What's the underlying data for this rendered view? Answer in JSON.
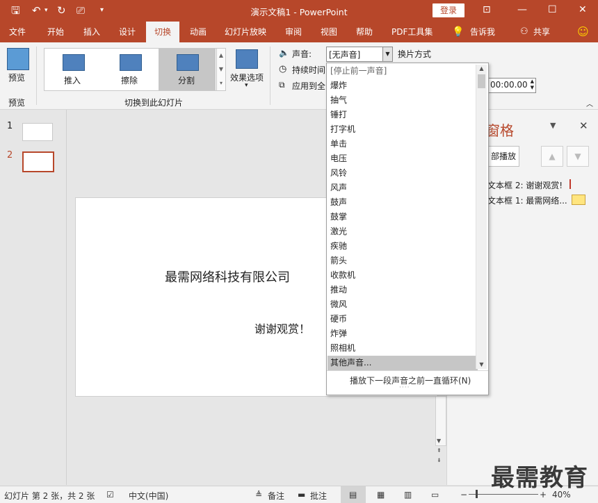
{
  "window": {
    "title": "演示文稿1  -  PowerPoint",
    "login": "登录"
  },
  "tabs": [
    "文件",
    "开始",
    "插入",
    "设计",
    "切换",
    "动画",
    "幻灯片放映",
    "审阅",
    "视图",
    "帮助",
    "PDF工具集",
    "告诉我",
    "共享"
  ],
  "ribbon": {
    "preview_label": "预览",
    "preview_group": "预览",
    "gallery": [
      "推入",
      "擦除",
      "分割"
    ],
    "effect_options": "效果选项",
    "transition_group": "切换到此幻灯片",
    "sound_label": "声音:",
    "sound_value": "[无声音]",
    "switch_mode": "换片方式",
    "duration_label": "持续时间",
    "apply_all": "应用到全",
    "time_value": "00:00.00"
  },
  "thumbnails": [
    {
      "num": "1"
    },
    {
      "num": "2"
    }
  ],
  "slide": {
    "title": "最需网络科技有限公司",
    "subtitle": "谢谢观赏！"
  },
  "pane": {
    "title": "窗格",
    "play_all": "部播放",
    "items": [
      "文本框 2: 谢谢观赏!",
      "文本框 1: 最需网络..."
    ]
  },
  "dropdown": {
    "items": [
      "[停止前一声音]",
      "爆炸",
      "抽气",
      "锤打",
      "打字机",
      "单击",
      "电压",
      "风铃",
      "风声",
      "鼓声",
      "鼓掌",
      "激光",
      "疾驰",
      "箭头",
      "收款机",
      "推动",
      "微风",
      "硬币",
      "炸弹",
      "照相机",
      "其他声音..."
    ],
    "loop": "播放下一段声音之前一直循环(N)"
  },
  "status": {
    "slide_info": "幻灯片 第 2 张，共 2 张",
    "language": "中文(中国)",
    "notes": "备注",
    "comments": "批注",
    "zoom": "40%"
  },
  "watermark": "最需教育",
  "colors": {
    "accent": "#b7472a"
  }
}
